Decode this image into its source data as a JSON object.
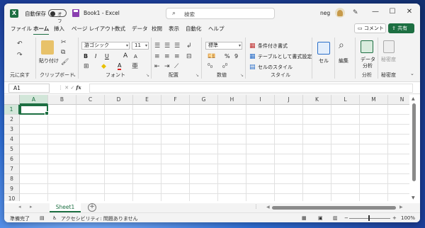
{
  "titlebar": {
    "autosave_label": "自動保存",
    "autosave_state": "オフ",
    "doc_title": "Book1  -  Excel",
    "search_placeholder": "検索",
    "user_name": "neg",
    "minimize": "—",
    "maximize": "☐",
    "close": "✕"
  },
  "tabs": [
    "ファイル",
    "ホーム",
    "挿入",
    "ページ レイアウト",
    "数式",
    "データ",
    "校閲",
    "表示",
    "自動化",
    "ヘルプ"
  ],
  "active_tab": "ホーム",
  "comment_button": "コメント",
  "share_button": "共有",
  "ribbon": {
    "undo": {
      "label": "元に戻す"
    },
    "clipboard": {
      "label": "クリップボード",
      "paste": "貼り付け"
    },
    "font": {
      "label": "フォント",
      "font_name": "游ゴシック",
      "font_size": "11",
      "bold": "B",
      "italic": "I",
      "underline": "U",
      "grow": "A",
      "shrink": "A",
      "font_color": "A"
    },
    "alignment": {
      "label": "配置"
    },
    "number": {
      "label": "数値",
      "format": "標準",
      "percent": "%",
      "comma": "9"
    },
    "styles": {
      "label": "スタイル",
      "conditional": "条件付き書式",
      "as_table": "テーブルとして書式設定",
      "cell_styles": "セルのスタイル"
    },
    "cells": {
      "button": "セル"
    },
    "editing": {
      "button": "編集"
    },
    "analysis": {
      "button_line1": "データ",
      "button_line2": "分析",
      "label": "分析"
    },
    "sensitivity": {
      "button": "秘密度",
      "label": "秘密度"
    }
  },
  "formula_bar": {
    "namebox": "A1",
    "fx": "fx",
    "value": ""
  },
  "grid": {
    "columns": [
      "A",
      "B",
      "C",
      "D",
      "E",
      "F",
      "G",
      "H",
      "I",
      "J",
      "K",
      "L",
      "M",
      "N"
    ],
    "rows": [
      "1",
      "2",
      "3",
      "4",
      "5",
      "6",
      "7",
      "8",
      "9",
      "10"
    ],
    "selected": "A1"
  },
  "sheets": [
    "Sheet1"
  ],
  "statusbar": {
    "ready": "準備完了",
    "accessibility": "アクセシビリティ: 問題ありません",
    "zoom": "100%",
    "zoom_minus": "−",
    "zoom_plus": "+"
  },
  "colors": {
    "excel_green": "#1d6f42",
    "accent_purple": "#8a3fb0"
  }
}
